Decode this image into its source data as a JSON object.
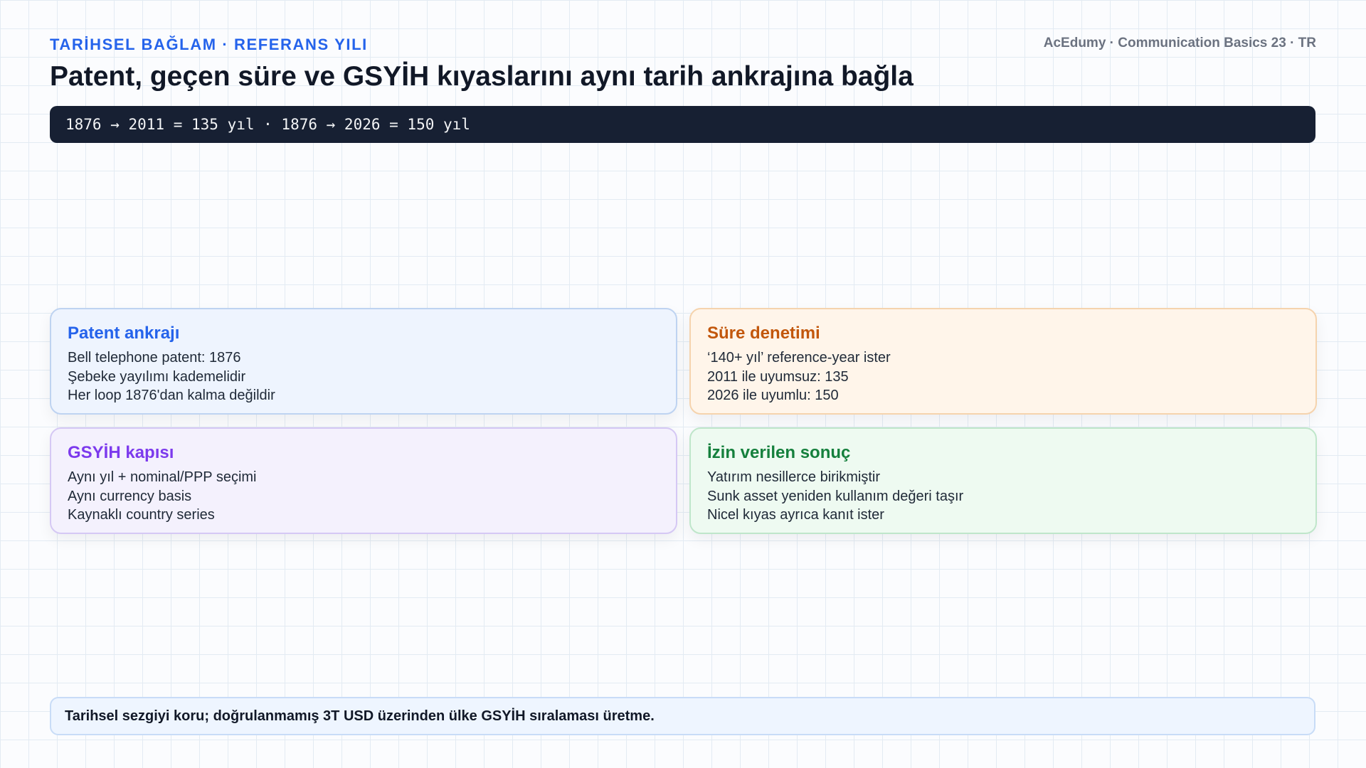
{
  "header": {
    "eyebrow": "TARİHSEL BAĞLAM · REFERANS YILI",
    "brand": "AcEdumy · Communication Basics 23 · TR",
    "title": "Patent, geçen süre ve GSYİH kıyaslarını aynı tarih ankrajına bağla"
  },
  "formula": "1876 → 2011 = 135 yıl · 1876 → 2026 = 150 yıl",
  "cards": [
    {
      "title": "Patent ankrajı",
      "accent": "#2563eb",
      "lines": [
        "Bell telephone patent: 1876",
        "Şebeke yayılımı kademelidir",
        "Her loop 1876'dan kalma değildir"
      ]
    },
    {
      "title": "Süre denetimi",
      "accent": "#c2570c",
      "lines": [
        "‘140+ yıl’ reference-year ister",
        "2011 ile uyumsuz: 135",
        "2026 ile uyumlu: 150"
      ]
    },
    {
      "title": "GSYİH kapısı",
      "accent": "#7c3aed",
      "lines": [
        "Aynı yıl + nominal/PPP seçimi",
        "Aynı currency basis",
        "Kaynaklı country series"
      ]
    },
    {
      "title": "İzin verilen sonuç",
      "accent": "#15803d",
      "lines": [
        "Yatırım nesillerce birikmiştir",
        "Sunk asset yeniden kullanım değeri taşır",
        "Nicel kıyas ayrıca kanıt ister"
      ]
    }
  ],
  "footer": {
    "note": "Tarihsel sezgiyi koru; doğrulanmamış 3T USD üzerinden ülke GSYİH sıralaması üretme."
  }
}
